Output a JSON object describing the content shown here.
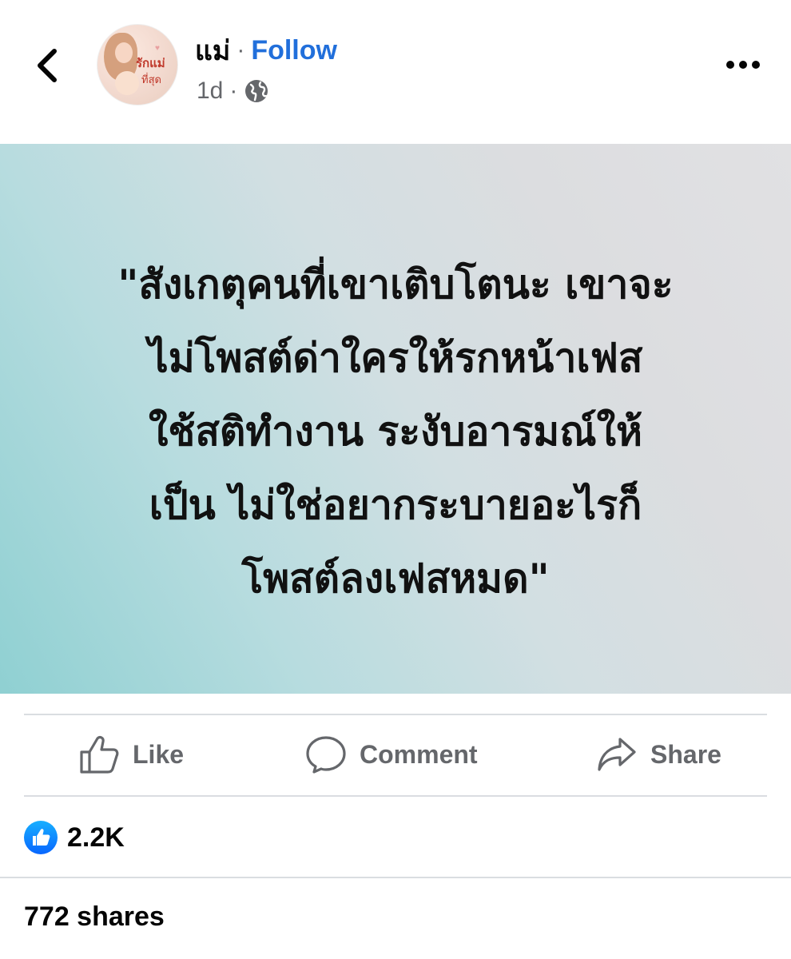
{
  "header": {
    "page_name": "แม่",
    "separator": "·",
    "follow_label": "Follow",
    "time": "1d",
    "time_separator": "·",
    "privacy_icon": "globe-icon",
    "avatar_text_line1": "รักแม่",
    "avatar_text_line2": "ที่สุด"
  },
  "post": {
    "quote_lines": [
      "\"สังเกตุคนที่เขาเติบโตนะ เขาจะ",
      "ไม่โพสต์ด่าใครให้รกหน้าเฟส",
      "ใช้สติทำงาน ระงับอารมณ์ให้",
      "เป็น ไม่ใช่อยากระบายอะไรก็",
      "โพสต์ลงเฟสหมด\""
    ],
    "background_colors": [
      "#8fd0d2",
      "#e1e1e3"
    ]
  },
  "actions": {
    "like_label": "Like",
    "comment_label": "Comment",
    "share_label": "Share"
  },
  "stats": {
    "reaction_count": "2.2K",
    "shares": "772 shares"
  },
  "colors": {
    "accent": "#216fdb",
    "secondary_text": "#65676b",
    "like_blue": "#0866ff"
  }
}
